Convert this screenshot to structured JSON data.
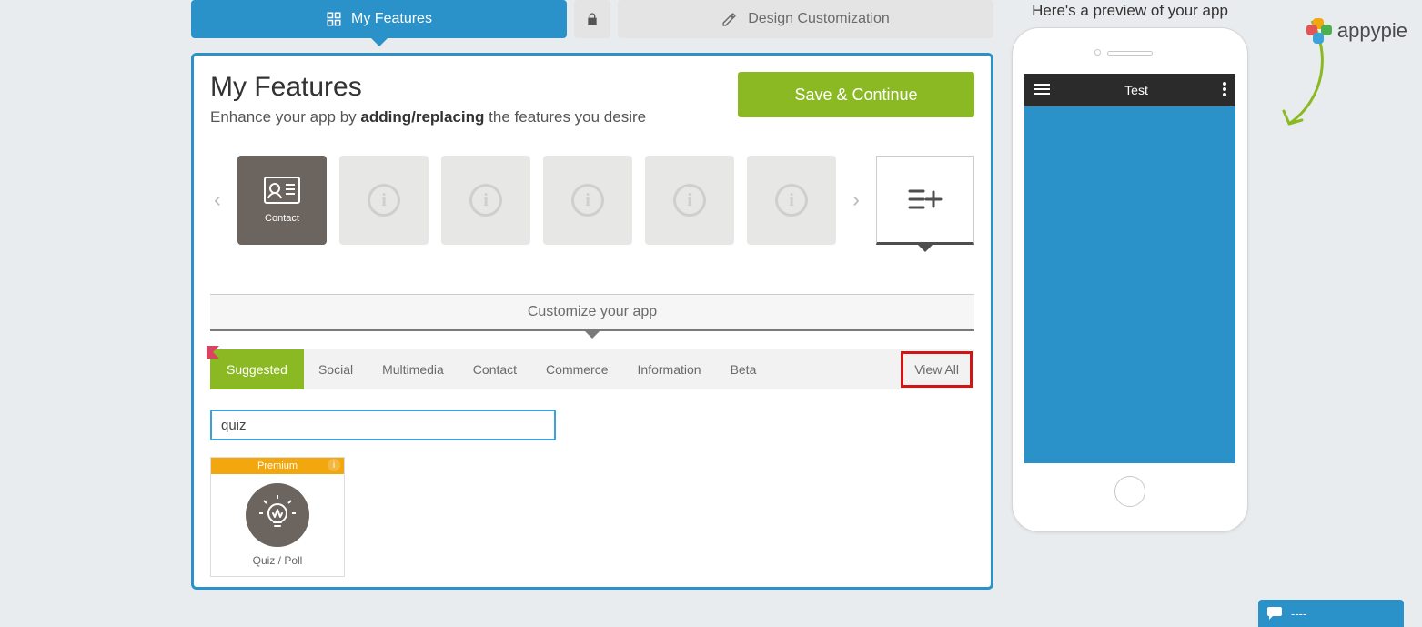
{
  "tabs": {
    "my_features": "My Features",
    "design_customization": "Design Customization"
  },
  "panel": {
    "title": "My Features",
    "subtitle_pre": "Enhance your app by ",
    "subtitle_bold": "adding/replacing",
    "subtitle_post": " the features you desire",
    "save_btn": "Save & Continue",
    "contact_slot": "Contact",
    "customize_strip": "Customize your app"
  },
  "categories": {
    "suggested": "Suggested",
    "social": "Social",
    "multimedia": "Multimedia",
    "contact": "Contact",
    "commerce": "Commerce",
    "information": "Information",
    "beta": "Beta",
    "view_all": "View All"
  },
  "search": {
    "value": "quiz"
  },
  "feature_card": {
    "badge": "Premium",
    "label": "Quiz / Poll"
  },
  "preview": {
    "heading": "Here's a preview of your app",
    "app_title": "Test"
  },
  "brand": {
    "name": "appypie"
  },
  "chat": {
    "label": "----"
  }
}
